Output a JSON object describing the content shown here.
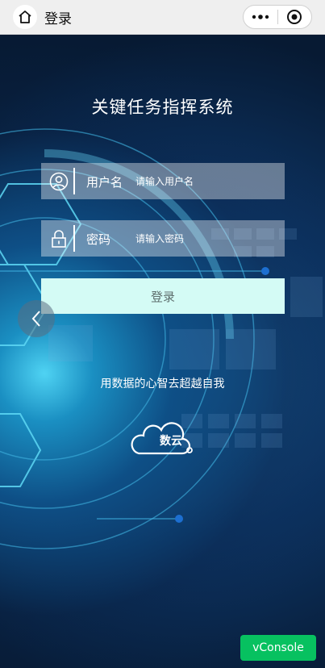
{
  "topbar": {
    "title": "登录",
    "home_icon": "home-icon",
    "more_icon": "more-dots-icon",
    "close_icon": "target-circle-icon"
  },
  "app": {
    "title": "关键任务指挥系统",
    "username": {
      "label": "用户名",
      "placeholder": "请输入用户名",
      "value": "",
      "icon": "user-icon"
    },
    "password": {
      "label": "密码",
      "placeholder": "请输入密码",
      "value": "",
      "icon": "lock-icon"
    },
    "login_button": "登录",
    "slogan": "用数据的心智去超越自我",
    "logo_text": "数云"
  },
  "overlay": {
    "back_icon": "chevron-left-icon",
    "vconsole_label": "vConsole"
  },
  "colors": {
    "accent": "#07c160",
    "button_bg": "#d4fbf5",
    "background": "#08182c"
  }
}
